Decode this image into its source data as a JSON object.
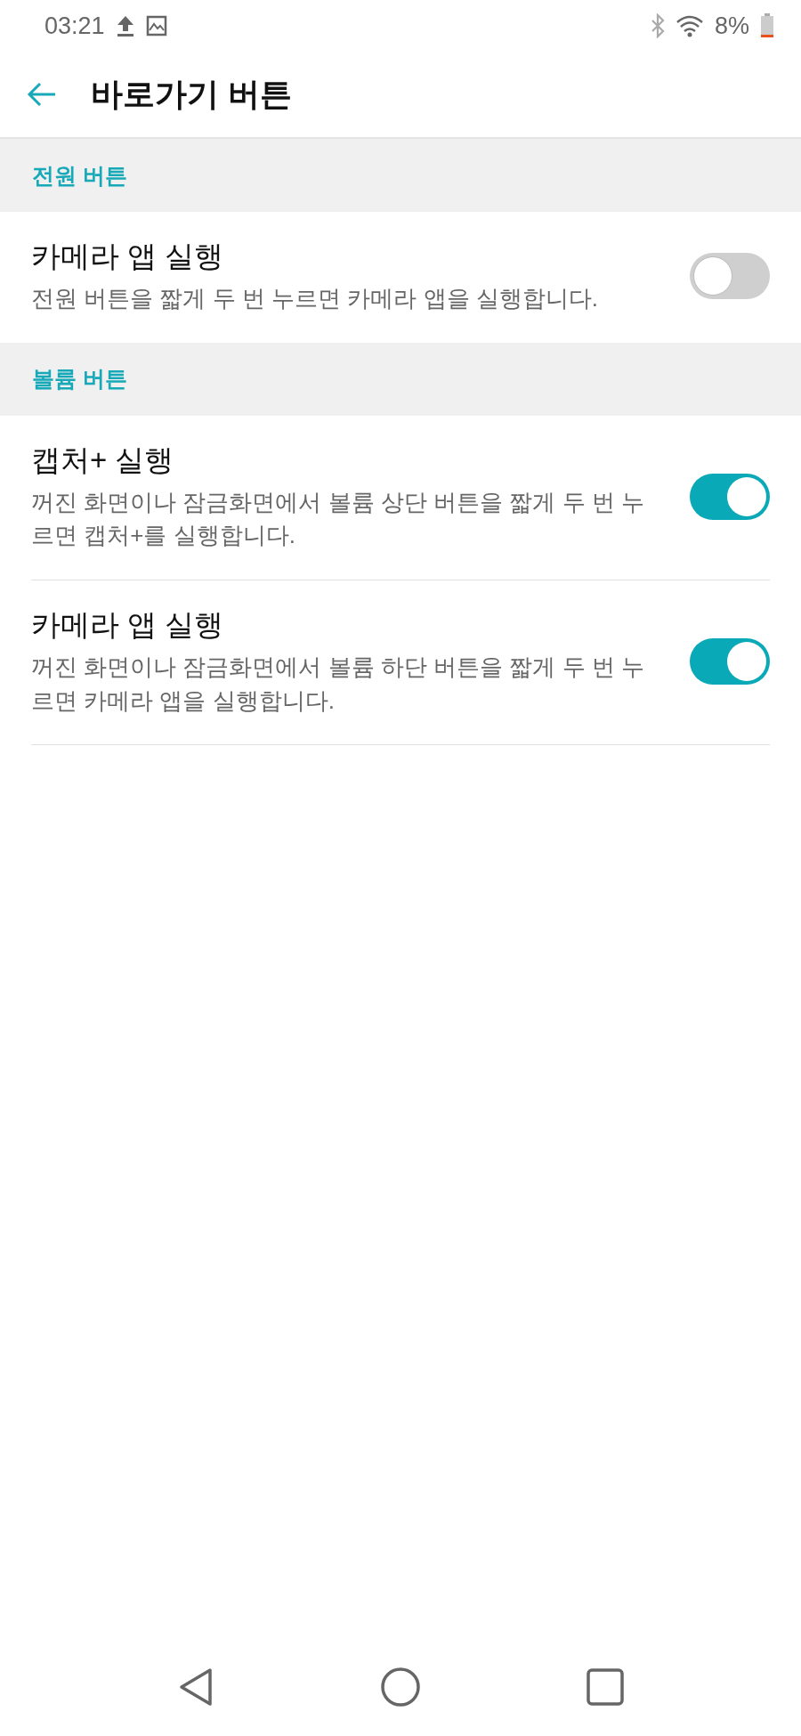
{
  "status_bar": {
    "time": "03:21",
    "battery": "8%"
  },
  "app_bar": {
    "title": "바로가기 버튼"
  },
  "sections": [
    {
      "header": "전원 버튼",
      "items": [
        {
          "title": "카메라 앱 실행",
          "description": "전원 버튼을 짧게 두 번 누르면 카메라 앱을 실행합니다.",
          "on": false
        }
      ]
    },
    {
      "header": "볼륨 버튼",
      "items": [
        {
          "title": "캡처+ 실행",
          "description": "꺼진 화면이나 잠금화면에서 볼륨 상단 버튼을 짧게 두 번 누르면 캡처+를 실행합니다.",
          "on": true
        },
        {
          "title": "카메라 앱 실행",
          "description": "꺼진 화면이나 잠금화면에서 볼륨 하단 버튼을 짧게 두 번 누르면 카메라 앱을 실행합니다.",
          "on": true
        }
      ]
    }
  ]
}
